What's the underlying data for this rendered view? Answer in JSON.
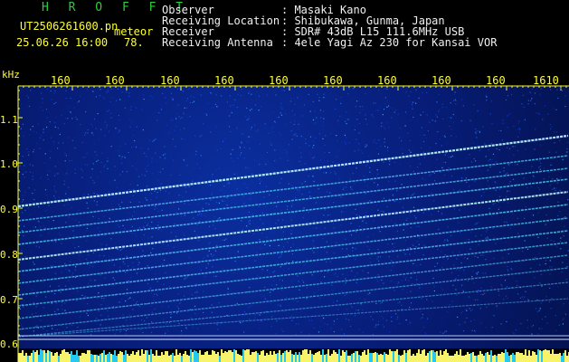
{
  "header": {
    "brand": "H R O F F T",
    "filename": "UT2506261600.pn",
    "tag": "meteor",
    "datetime": "25.06.26 16:00",
    "level": "78.",
    "labels": [
      "Observer",
      "Receiving Location",
      "Receiver",
      "Receiving Antenna"
    ],
    "values": [
      ": Masaki Kano",
      ": Shibukawa, Gunma, Japan",
      ": SDR# 43dB L15 111.6MHz USB",
      ": 4ele Yagi Az 230 for Kansai VOR"
    ]
  },
  "y_axis": {
    "unit": "kHz",
    "ticks": [
      "1.1",
      "1.0",
      "0.9",
      "0.8",
      "0.7",
      "0.6"
    ]
  },
  "x_axis": {
    "ticks": [
      "160",
      "160",
      "160",
      "160",
      "160",
      "160",
      "160",
      "160",
      "160",
      "1610"
    ]
  },
  "colors": {
    "background": "#071d78",
    "trace": "#59d7ff",
    "trace_bright": "#b8f3ff",
    "axis_text": "#ffff33",
    "brand": "#2ecc40",
    "bottom_strip": "#f7f36a",
    "bottom_cyan": "#24c8f0"
  }
}
